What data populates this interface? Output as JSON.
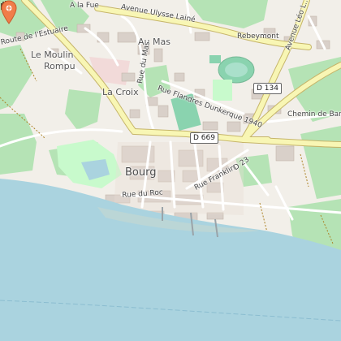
{
  "map": {
    "labels": {
      "a_la_fue": "A la Fue",
      "ulysse_laine": "Avenue Ulysse Lainé",
      "route_estuaire": "Route de l'Estuaire",
      "le_moulin": "Le Moulin",
      "rompu": "Rompu",
      "au_mas": "Au Mas",
      "rebeymont": "Rebeymont",
      "avenue_leo": "Avenue Léo L...",
      "rue_mas": "Rue du Mas",
      "la_croix": "La Croix",
      "rue_flandres": "Rue Flandres Dunkerque 1940",
      "chemin_banl": "Chemin de Banl...",
      "bourg": "Bourg",
      "rue_franklin": "Rue Franklin",
      "rue_roc": "Rue du Roc",
      "d23": "D 23"
    },
    "shields": {
      "d134": "D 134",
      "d669": "D 669"
    },
    "marker": {
      "icon": "map-pin-icon",
      "color": "#f07d4a"
    },
    "poi": {
      "icon": "castle-icon"
    },
    "colors": {
      "land": "#f2efe9",
      "water": "#aad3df",
      "vineyard": "#b5e3b5",
      "park": "#c8facc",
      "road_major": "#f8f6b4",
      "road_casing": "#c6b56a",
      "building": "#d9d0c9",
      "pitch": "#8ad3af"
    }
  }
}
